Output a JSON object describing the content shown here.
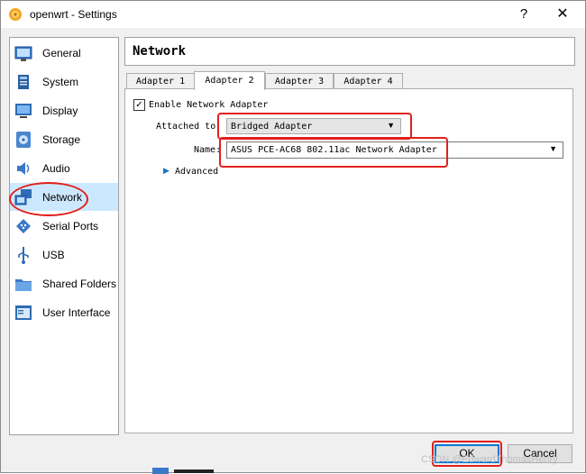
{
  "window": {
    "title": "openwrt - Settings",
    "help_glyph": "?",
    "close_glyph": "✕"
  },
  "sidebar": {
    "items": [
      {
        "label": "General",
        "icon": "general-icon"
      },
      {
        "label": "System",
        "icon": "system-icon"
      },
      {
        "label": "Display",
        "icon": "display-icon"
      },
      {
        "label": "Storage",
        "icon": "storage-icon"
      },
      {
        "label": "Audio",
        "icon": "audio-icon"
      },
      {
        "label": "Network",
        "icon": "network-icon",
        "selected": true
      },
      {
        "label": "Serial Ports",
        "icon": "serial-ports-icon"
      },
      {
        "label": "USB",
        "icon": "usb-icon"
      },
      {
        "label": "Shared Folders",
        "icon": "shared-folders-icon"
      },
      {
        "label": "User Interface",
        "icon": "user-interface-icon"
      }
    ]
  },
  "page": {
    "title": "Network"
  },
  "tabs": {
    "items": [
      {
        "label": "Adapter 1"
      },
      {
        "label": "Adapter 2",
        "selected": true
      },
      {
        "label": "Adapter 3"
      },
      {
        "label": "Adapter 4"
      }
    ]
  },
  "adapter": {
    "enable_label": "Enable Network Adapter",
    "enable_checked": true,
    "check_glyph": "✓",
    "attached_label": "Attached to:",
    "attached_value": "Bridged Adapter",
    "name_label": "Name:",
    "name_value": "ASUS PCE-AC68 802.11ac Network Adapter",
    "advanced_label": "Advanced",
    "dropdown_glyph": "▼",
    "expand_glyph": "▶"
  },
  "buttons": {
    "ok": "OK",
    "cancel": "Cancel"
  },
  "watermark": "CSDN @EdwardThomasHenry",
  "colors": {
    "accent": "#0078d7",
    "selection": "#cce8ff",
    "annotation": "#e0201c"
  }
}
